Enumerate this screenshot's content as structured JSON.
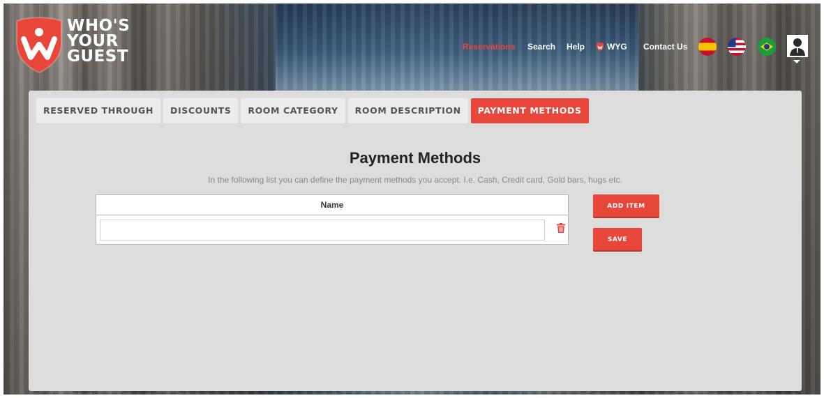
{
  "brand": {
    "logo_lines": [
      "WHO'S",
      "YOUR",
      "GUEST"
    ],
    "accent_color": "#e8463a"
  },
  "nav": {
    "reservations": "Reservations",
    "search": "Search",
    "help": "Help",
    "wyg": "WYG",
    "contact": "Contact Us",
    "flags": [
      "spain-flag-icon",
      "usa-flag-icon",
      "brazil-flag-icon"
    ],
    "avatar_icon": "user-avatar-icon"
  },
  "tabs": [
    {
      "label": "RESERVED THROUGH",
      "active": false
    },
    {
      "label": "DISCOUNTS",
      "active": false
    },
    {
      "label": "ROOM CATEGORY",
      "active": false
    },
    {
      "label": "ROOM DESCRIPTION",
      "active": false
    },
    {
      "label": "PAYMENT METHODS",
      "active": true
    }
  ],
  "main": {
    "title": "Payment Methods",
    "description": "In the following list you can define the payment methods you accept. I.e. Cash, Credit card, Gold bars, hugs etc.",
    "table": {
      "column_header": "Name",
      "rows": [
        {
          "value": ""
        }
      ]
    },
    "add_item_label": "ADD ITEM",
    "save_label": "SAVE"
  }
}
